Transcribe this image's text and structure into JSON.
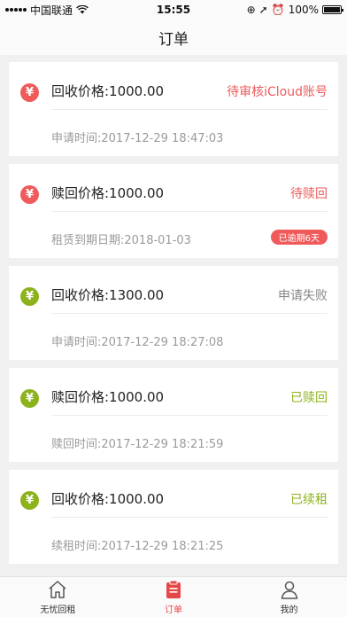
{
  "status_bar": {
    "carrier": "中国联通",
    "time": "15:55",
    "battery": "100%",
    "battery_level": 1.0
  },
  "header": {
    "title": "订单"
  },
  "orders": [
    {
      "price_label": "回收价格:1000.00",
      "status": "待审核iCloud账号",
      "time_label": "申请时间:2017-12-29 18:47:03",
      "coin": "¥",
      "badge": ""
    },
    {
      "price_label": "赎回价格:1000.00",
      "status": "待赎回",
      "time_label": "租赁到期日期:2018-01-03",
      "coin": "¥",
      "badge": "已逾期6天"
    },
    {
      "price_label": "回收价格:1300.00",
      "status": "申请失败",
      "time_label": "申请时间:2017-12-29 18:27:08",
      "coin": "¥",
      "badge": ""
    },
    {
      "price_label": "赎回价格:1000.00",
      "status": "已赎回",
      "time_label": "赎回时间:2017-12-29 18:21:59",
      "coin": "¥",
      "badge": ""
    },
    {
      "price_label": "回收价格:1000.00",
      "status": "已续租",
      "time_label": "续租时间:2017-12-29 18:21:25",
      "coin": "¥",
      "badge": ""
    }
  ],
  "tabs": [
    {
      "label": "无忧回租",
      "icon": "home-icon"
    },
    {
      "label": "订单",
      "icon": "clipboard-icon",
      "active": true
    },
    {
      "label": "我的",
      "icon": "user-icon"
    }
  ],
  "colors": {
    "accent_red": "#ef5b5b",
    "accent_green": "#8cb21c",
    "muted_grey": "#888888"
  }
}
